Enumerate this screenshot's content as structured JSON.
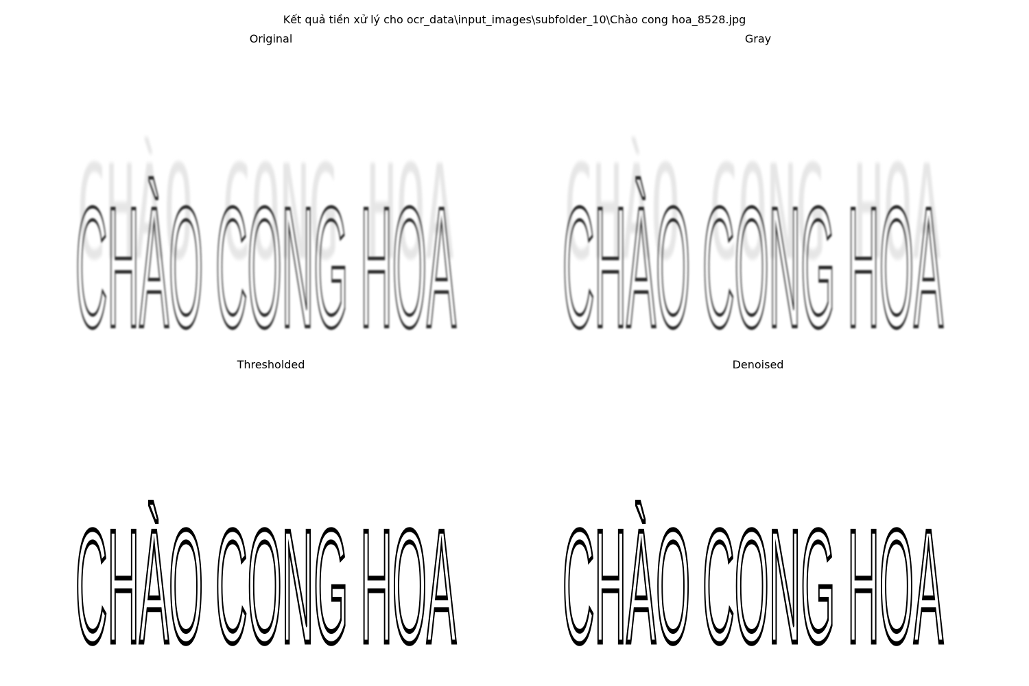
{
  "figure": {
    "suptitle": "Kết quả tiền xử lý cho ocr_data\\input_images\\subfolder_10\\Chào cong hoa_8528.jpg"
  },
  "panels": [
    {
      "title": "Original",
      "image_text": "CHÀO CONG HOA"
    },
    {
      "title": "Gray",
      "image_text": "CHÀO CONG HOA"
    },
    {
      "title": "Thresholded",
      "image_text": "CHÀO CONG HOA"
    },
    {
      "title": "Denoised",
      "image_text": "CHÀO CONG HOA"
    }
  ],
  "colors": {
    "original_ink": "#2b2b2b",
    "gray_ink": "#262626",
    "binary_ink": "#000000",
    "background": "#ffffff"
  }
}
